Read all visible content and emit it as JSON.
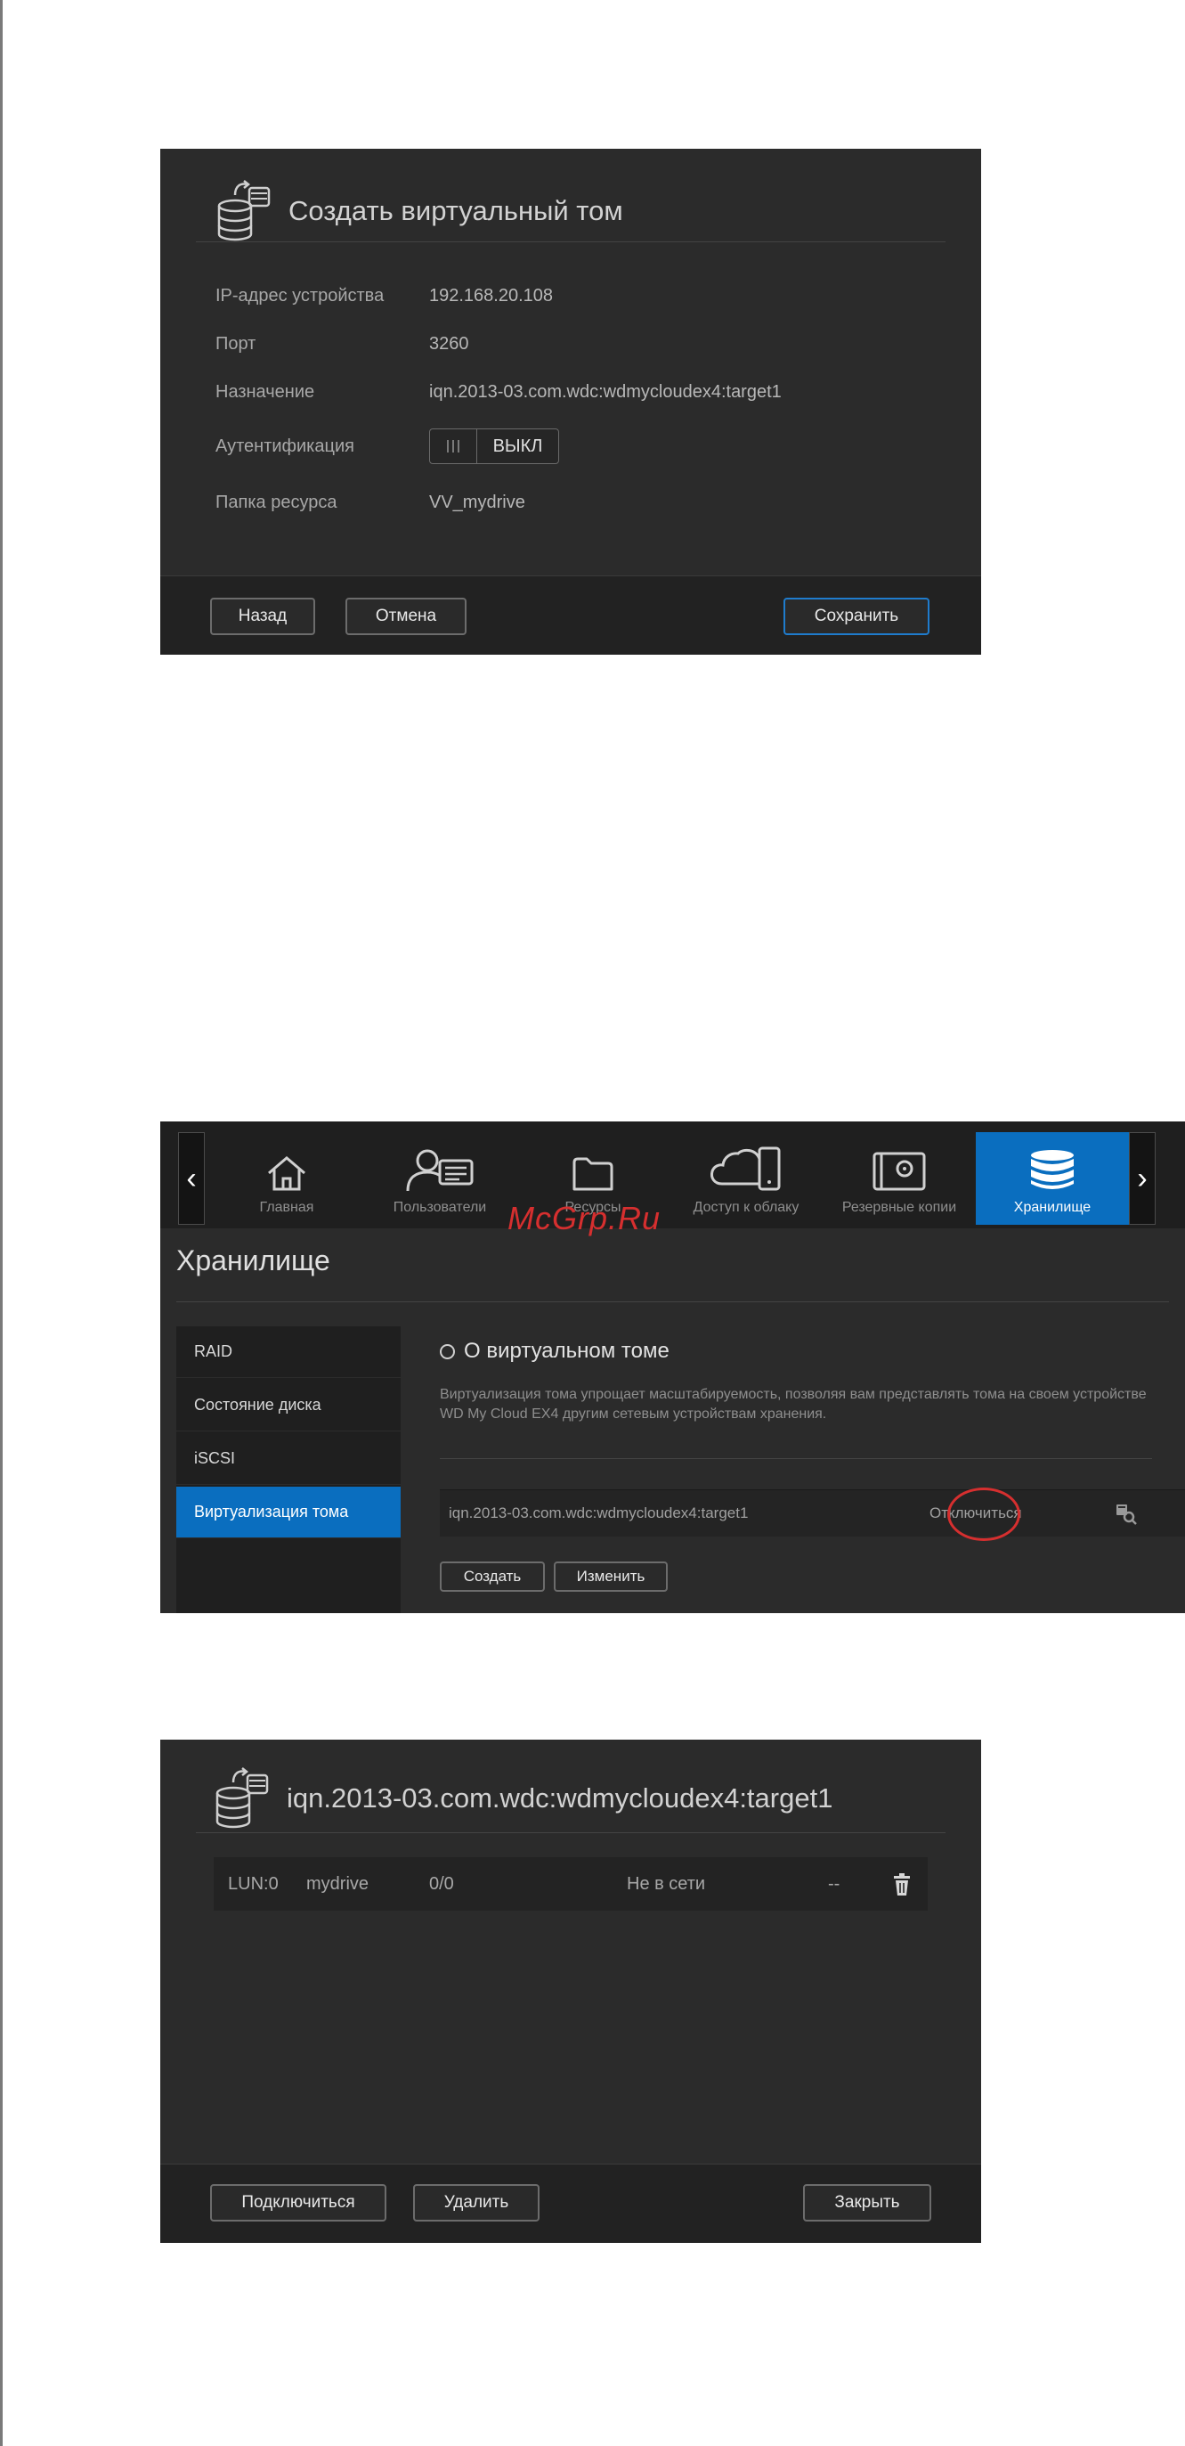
{
  "panel1": {
    "title": "Создать виртуальный том",
    "fields": [
      {
        "label": "IP-адрес устройства",
        "value": "192.168.20.108"
      },
      {
        "label": "Порт",
        "value": "3260"
      },
      {
        "label": "Назначение",
        "value": "iqn.2013-03.com.wdc:wdmycloudex4:target1"
      },
      {
        "label": "Аутентификация",
        "value": "ВЫКЛ"
      },
      {
        "label": "Папка ресурса",
        "value": "VV_mydrive"
      }
    ],
    "buttons": {
      "back": "Назад",
      "cancel": "Отмена",
      "save": "Сохранить"
    }
  },
  "panel2": {
    "nav": [
      {
        "label": "Главная",
        "icon": "home-icon"
      },
      {
        "label": "Пользователи",
        "icon": "users-icon"
      },
      {
        "label": "Ресурсы",
        "icon": "folder-icon"
      },
      {
        "label": "Доступ к облаку",
        "icon": "cloud-device-icon"
      },
      {
        "label": "Резервные копии",
        "icon": "safe-icon"
      },
      {
        "label": "Хранилище",
        "icon": "storage-icon",
        "active": true
      }
    ],
    "watermark": "McGrp.Ru",
    "title": "Хранилище",
    "sidebar": [
      {
        "label": "RAID"
      },
      {
        "label": "Состояние диска"
      },
      {
        "label": "iSCSI"
      },
      {
        "label": "Виртуализация тома",
        "active": true
      }
    ],
    "about_title": "О виртуальном томе",
    "description": "Виртуализация тома упрощает масштабируемость, позволяя вам представлять тома на своем устройстве WD My Cloud EX4 другим сетевым устройствам хранения.",
    "target": {
      "name": "iqn.2013-03.com.wdc:wdmycloudex4:target1",
      "status": "Отключиться"
    },
    "buttons": {
      "create": "Создать",
      "edit": "Изменить"
    }
  },
  "panel3": {
    "title": "iqn.2013-03.com.wdc:wdmycloudex4:target1",
    "lun": {
      "lun": "LUN:0",
      "name": "mydrive",
      "size": "0/0",
      "status": "Не в сети",
      "extra": "--"
    },
    "buttons": {
      "connect": "Подключиться",
      "delete": "Удалить",
      "close": "Закрыть"
    }
  },
  "colors": {
    "accent": "#0a6ebf",
    "highlight": "#d62f2f",
    "panel": "#2b2b2b"
  }
}
